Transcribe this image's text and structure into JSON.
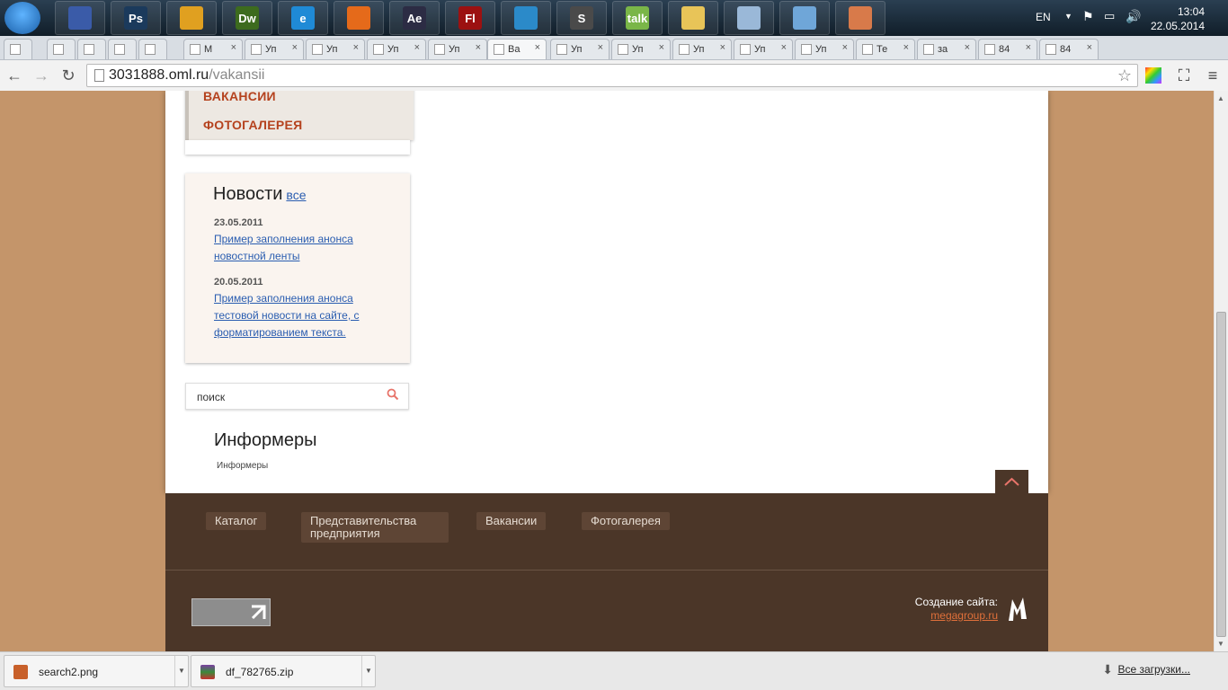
{
  "taskbar": {
    "apps": [
      {
        "name": "save-app",
        "label": "",
        "color": "#3a5ba8"
      },
      {
        "name": "photoshop-app",
        "label": "Ps",
        "color": "#1b3a5c"
      },
      {
        "name": "chrome-app",
        "label": "",
        "color": "#e0a020"
      },
      {
        "name": "dreamweaver-app",
        "label": "Dw",
        "color": "#3d6b1e"
      },
      {
        "name": "ie-app",
        "label": "e",
        "color": "#1f8ad6"
      },
      {
        "name": "firefox-app",
        "label": "",
        "color": "#e56a1a"
      },
      {
        "name": "aftereffects-app",
        "label": "Ae",
        "color": "#2c2c44"
      },
      {
        "name": "flash-app",
        "label": "Fl",
        "color": "#9c1111"
      },
      {
        "name": "media-app",
        "label": "",
        "color": "#2b8ac9"
      },
      {
        "name": "sublime-app",
        "label": "S",
        "color": "#4a4a4a"
      },
      {
        "name": "talk-app",
        "label": "talk",
        "color": "#7ab648"
      },
      {
        "name": "explorer-app",
        "label": "",
        "color": "#e8c458"
      },
      {
        "name": "calculator-app",
        "label": "",
        "color": "#9ab8d8"
      },
      {
        "name": "notepad-app",
        "label": "",
        "color": "#6fa6d8"
      },
      {
        "name": "paint-app",
        "label": "",
        "color": "#d87a4a"
      }
    ],
    "lang": "EN",
    "time": "13:04",
    "date": "22.05.2014"
  },
  "tabs": [
    {
      "title": "",
      "active": false
    },
    {
      "title": "",
      "active": false
    },
    {
      "title": "",
      "active": false
    },
    {
      "title": "",
      "active": false
    },
    {
      "title": "",
      "active": false
    },
    {
      "title": "M",
      "active": false
    },
    {
      "title": "Уп",
      "active": false
    },
    {
      "title": "Уп",
      "active": false
    },
    {
      "title": "Уп",
      "active": false
    },
    {
      "title": "Уп",
      "active": false
    },
    {
      "title": "Ва",
      "active": true
    },
    {
      "title": "Уп",
      "active": false
    },
    {
      "title": "Уп",
      "active": false
    },
    {
      "title": "Уп",
      "active": false
    },
    {
      "title": "Уп",
      "active": false
    },
    {
      "title": "Уп",
      "active": false
    },
    {
      "title": "Те",
      "active": false
    },
    {
      "title": "за",
      "active": false
    },
    {
      "title": "84",
      "active": false
    },
    {
      "title": "84",
      "active": false
    }
  ],
  "toolbar": {
    "url_host": "3031888.oml.ru",
    "url_path": "/vakansii"
  },
  "site": {
    "menu": [
      "ВАКАНСИИ",
      "ФОТОГАЛЕРЕЯ"
    ],
    "news": {
      "title": "Новости",
      "all": "все",
      "items": [
        {
          "date": "23.05.2011",
          "text": "Пример заполнения анонса новостной ленты"
        },
        {
          "date": "20.05.2011",
          "text": "Пример заполнения анонса тестовой новости на сайте, с форматированием текста."
        }
      ]
    },
    "search": {
      "value": "поиск"
    },
    "informers": {
      "title": "Информеры",
      "text": "Информеры"
    },
    "footer": {
      "nav": [
        "Каталог",
        "Представительства предприятия",
        "Вакансии",
        "Фотогалерея"
      ],
      "credit_label": "Создание сайта:",
      "credit_link": "megagroup.ru"
    }
  },
  "downloads": {
    "items": [
      {
        "name": "search2.png"
      },
      {
        "name": "df_782765.zip"
      }
    ],
    "all": "Все загрузки..."
  },
  "colors": {
    "background": "#c4956a",
    "footer": "#4b3628",
    "menu_text": "#b5421e",
    "link": "#2a5db0"
  }
}
